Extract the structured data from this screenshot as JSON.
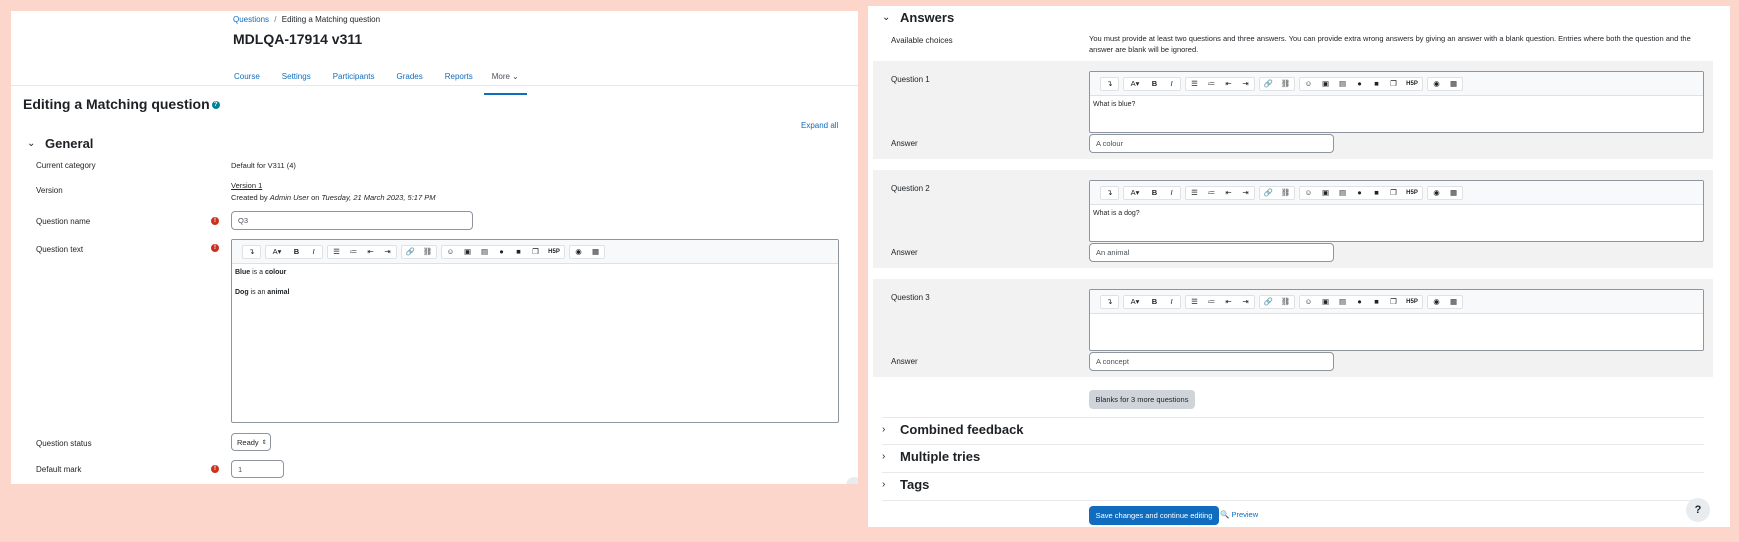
{
  "left": {
    "breadcrumb": {
      "item1": "Questions",
      "sep": "/",
      "item2": "Editing a Matching question"
    },
    "course_title": "MDLQA-17914 v311",
    "nav": {
      "course": "Course",
      "settings": "Settings",
      "participants": "Participants",
      "grades": "Grades",
      "reports": "Reports",
      "more": "More"
    },
    "page_heading": "Editing a Matching question",
    "expand_all": "Expand all",
    "general": {
      "title": "General",
      "current_category_label": "Current category",
      "current_category_value": "Default for V311 (4)",
      "version_label": "Version",
      "version_link": "Version 1",
      "created_by_prefix": "Created by",
      "created_by_user": "Admin User",
      "created_on_word": "on",
      "created_on_date": "Tuesday, 21 March 2023, 5:17 PM",
      "question_name_label": "Question name",
      "question_name_value": "Q3",
      "question_text_label": "Question text",
      "question_text_line1": {
        "a": "Blue",
        "b": " is a ",
        "c": "colour"
      },
      "question_text_line2": {
        "a": "Dog",
        "b": " is an ",
        "c": "animal"
      },
      "question_status_label": "Question status",
      "question_status_value": "Ready",
      "default_mark_label": "Default mark",
      "default_mark_value": "1"
    }
  },
  "right": {
    "answers_title": "Answers",
    "available_choices_label": "Available choices",
    "available_choices_text": "You must provide at least two questions and three answers. You can provide extra wrong answers by giving an answer with a blank question. Entries where both the question and the answer are blank will be ignored.",
    "questions": [
      {
        "label": "Question 1",
        "text": "What is blue?",
        "answer_label": "Answer",
        "answer": "A colour"
      },
      {
        "label": "Question 2",
        "text": "What is a dog?",
        "answer_label": "Answer",
        "answer": "An animal"
      },
      {
        "label": "Question 3",
        "text": "",
        "answer_label": "Answer",
        "answer": "A concept"
      }
    ],
    "blanks_button": "Blanks for 3 more questions",
    "sections": {
      "combined_feedback": "Combined feedback",
      "multiple_tries": "Multiple tries",
      "tags": "Tags"
    },
    "save_button": "Save changes and continue editing",
    "preview_link": "Preview",
    "help_button": "?"
  },
  "colors": {
    "accent": "#0f6cbf",
    "required": "#ca3120",
    "background": "#fcd5cb"
  }
}
